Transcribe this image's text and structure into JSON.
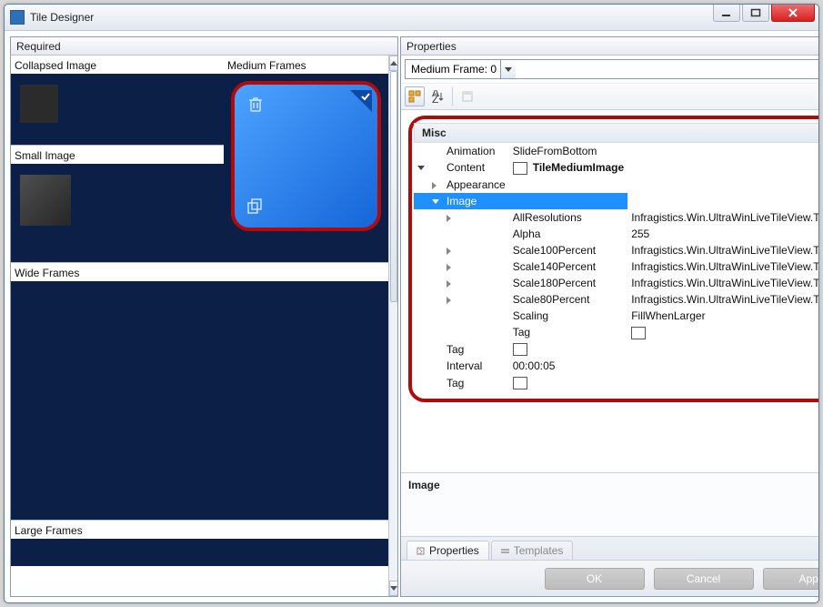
{
  "window": {
    "title": "Tile Designer"
  },
  "left": {
    "header": "Required",
    "sections": {
      "collapsed": "Collapsed Image",
      "small": "Small Image",
      "medium": "Medium Frames",
      "wide": "Wide Frames",
      "large": "Large Frames"
    }
  },
  "right": {
    "header": "Properties",
    "combo_label": "Medium Frame: 0",
    "category": "Misc",
    "rows": {
      "animation": {
        "name": "Animation",
        "value": "SlideFromBottom"
      },
      "content": {
        "name": "Content",
        "value": "TileMediumImage"
      },
      "appearance": {
        "name": "Appearance"
      },
      "image": {
        "name": "Image"
      },
      "allres": {
        "name": "AllResolutions",
        "value": "Infragistics.Win.UltraWinLiveTileView.TileImage"
      },
      "alpha": {
        "name": "Alpha",
        "value": "255"
      },
      "s100": {
        "name": "Scale100Percent",
        "value": "Infragistics.Win.UltraWinLiveTileView.TileImage"
      },
      "s140": {
        "name": "Scale140Percent",
        "value": "Infragistics.Win.UltraWinLiveTileView.TileImage"
      },
      "s180": {
        "name": "Scale180Percent",
        "value": "Infragistics.Win.UltraWinLiveTileView.TileImage"
      },
      "s80": {
        "name": "Scale80Percent",
        "value": "Infragistics.Win.UltraWinLiveTileView.TileImage"
      },
      "scaling": {
        "name": "Scaling",
        "value": "FillWhenLarger"
      },
      "tag_inner": {
        "name": "Tag"
      },
      "tag_mid": {
        "name": "Tag"
      },
      "interval": {
        "name": "Interval",
        "value": "00:00:05"
      },
      "tag_outer": {
        "name": "Tag"
      }
    },
    "description_title": "Image",
    "tabs": {
      "properties": "Properties",
      "templates": "Templates"
    }
  },
  "buttons": {
    "ok": "OK",
    "cancel": "Cancel",
    "apply": "Apply"
  }
}
